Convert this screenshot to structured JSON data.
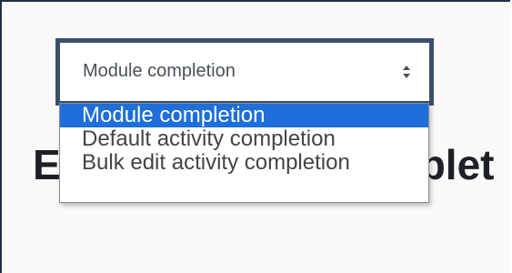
{
  "page": {
    "heading_fragment_left": "E",
    "heading_fragment_right": "plet"
  },
  "select": {
    "value": "Module completion",
    "arrows_icon": "up-down-arrows-icon",
    "options": [
      {
        "label": "Module completion",
        "selected": true
      },
      {
        "label": "Default activity completion",
        "selected": false
      },
      {
        "label": "Bulk edit activity completion",
        "selected": false
      }
    ]
  },
  "colors": {
    "highlight": "#1e6fd9",
    "select_border": "#3a4f6c",
    "heading": "#1d2125"
  }
}
